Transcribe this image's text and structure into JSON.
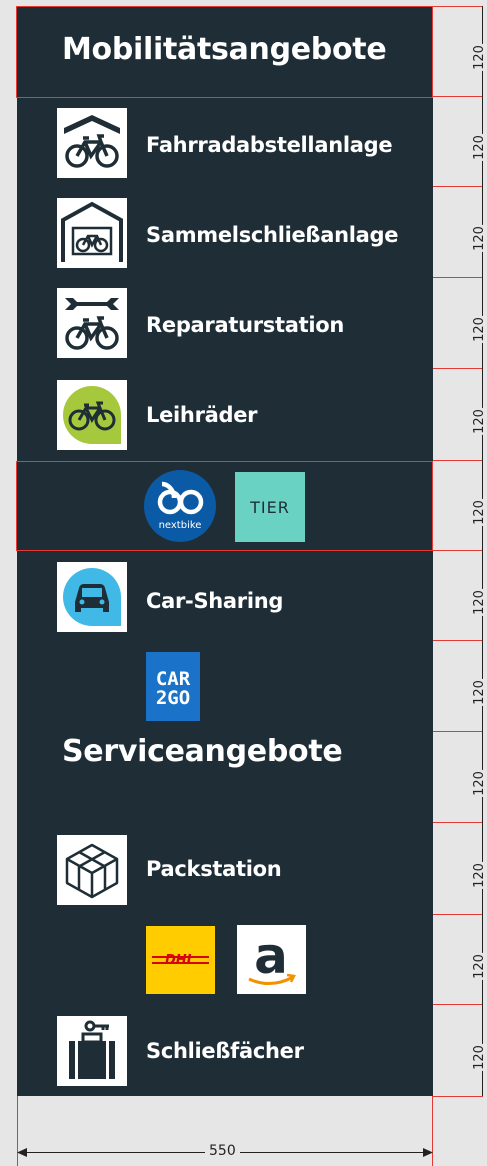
{
  "sections": {
    "mobility_title": "Mobilitätsangebote",
    "service_title": "Serviceangebote"
  },
  "items": {
    "bike_parking": "Fahrradabstellanlage",
    "bike_locker": "Sammelschließanlage",
    "repair": "Reparaturstation",
    "rental": "Leihräder",
    "carsharing": "Car-Sharing",
    "packstation": "Packstation",
    "lockers": "Schließfächer"
  },
  "logos": {
    "nextbike": "nextbike",
    "tier": "TIER",
    "car2go_line1": "CAR",
    "car2go_line2": "2GO",
    "dhl": "DHL",
    "amazon": "a"
  },
  "dimensions": {
    "row_height": "120",
    "width": "550"
  },
  "colors": {
    "panel": "#1f2e36",
    "rental_green": "#a5c83c",
    "carsharing_blue": "#41b9e6",
    "nextbike_blue": "#0a5aa5",
    "tier_teal": "#69d2c3",
    "car2go_blue": "#1a73c8",
    "dhl_yellow": "#ffcc00",
    "dhl_red": "#d40511",
    "dimension_red": "#e53935"
  }
}
